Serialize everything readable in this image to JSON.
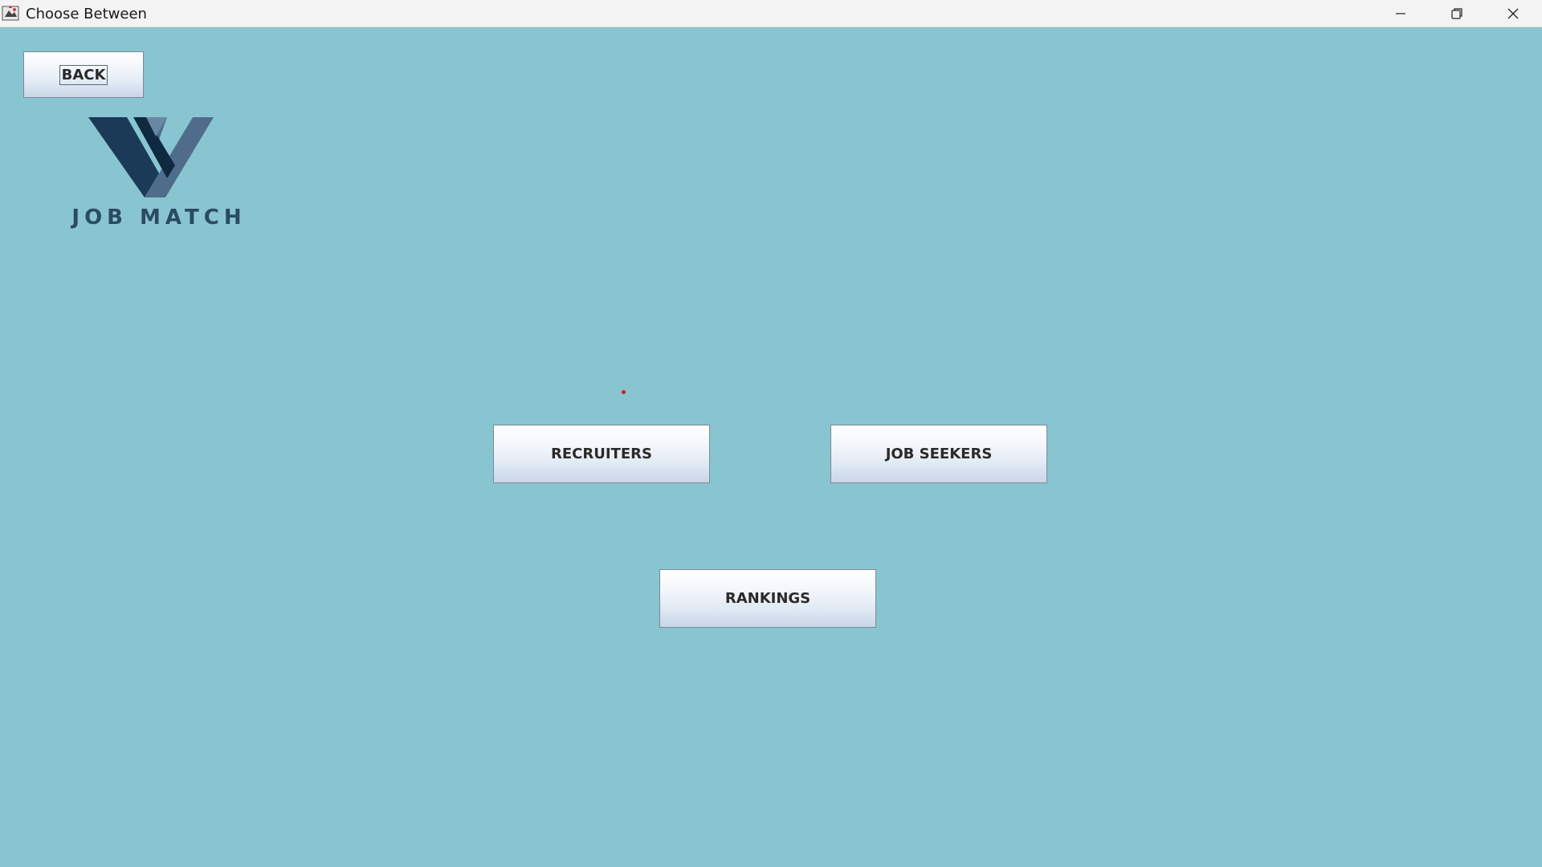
{
  "window": {
    "title": "Choose Between",
    "controls": {
      "minimize": "minimize-icon",
      "maximize": "restore-icon",
      "close": "close-icon"
    }
  },
  "buttons": {
    "back": "BACK",
    "recruiters": "RECRUITERS",
    "job_seekers": "JOB SEEKERS",
    "rankings": "RANKINGS"
  },
  "logo": {
    "text": "JOB MATCH",
    "icon": "w-logo-icon"
  },
  "colors": {
    "background": "#89c5d1",
    "logo_dark": "#1b3a57",
    "logo_light": "#4f6d8a"
  }
}
